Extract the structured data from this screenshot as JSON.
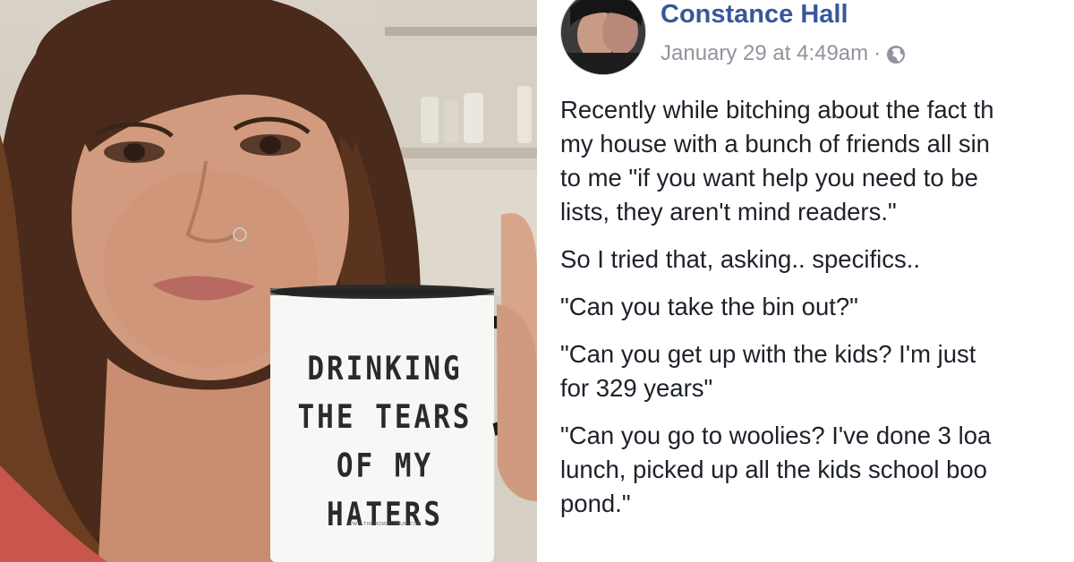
{
  "mug": {
    "lines": [
      "DRINKING",
      "THE TEARS",
      "OF MY",
      "HATERS"
    ],
    "url": "WWW.THEMOMSFORUM.COM"
  },
  "post": {
    "author": "Constance Hall",
    "timestamp": "January 29 at 4:49am",
    "separator": "·",
    "privacy_icon": "globe-icon",
    "paragraphs": [
      [
        "Recently while bitching about the fact th",
        "my house with a bunch of friends all sin",
        "to me \"if you want help you need to be",
        "lists, they aren't mind readers.\""
      ],
      [
        "So I tried that, asking.. specifics.."
      ],
      [
        "\"Can you take the bin out?\""
      ],
      [
        "\"Can you get up with the kids? I'm just",
        "for 329 years\""
      ],
      [
        "\"Can you go to woolies? I've done 3 loa",
        "lunch, picked up all the kids school boo",
        "pond.\""
      ]
    ]
  },
  "colors": {
    "author_link": "#365899",
    "meta_text": "#90949c",
    "body_text": "#1d2129"
  }
}
